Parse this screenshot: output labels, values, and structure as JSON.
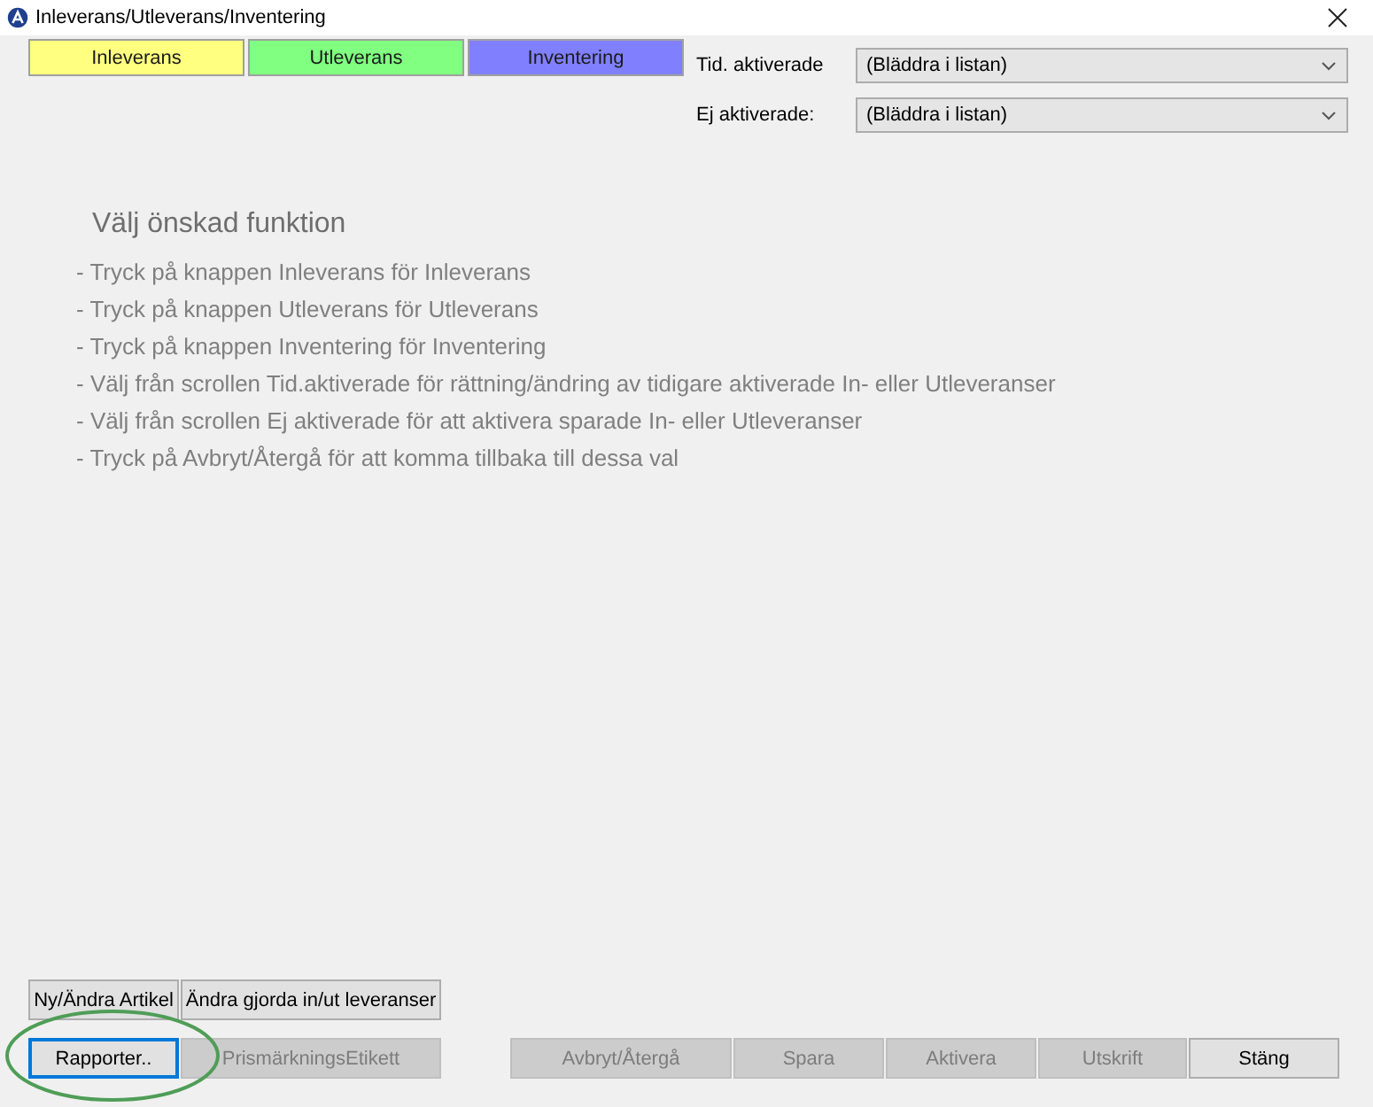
{
  "window": {
    "title": "Inleverans/Utleverans/Inventering"
  },
  "mode_buttons": [
    {
      "label": "Inleverans",
      "color": "#ffff80"
    },
    {
      "label": "Utleverans",
      "color": "#80ff80"
    },
    {
      "label": "Inventering",
      "color": "#8080ff"
    }
  ],
  "filters": [
    {
      "label": "Tid. aktiverade",
      "value": "(Bläddra i listan)"
    },
    {
      "label": "Ej aktiverade:",
      "value": "(Bläddra i listan)"
    }
  ],
  "instructions": {
    "heading": "Välj önskad funktion",
    "lines": [
      "- Tryck på knappen Inleverans för Inleverans",
      "- Tryck på knappen Utleverans för Utleverans",
      "- Tryck på knappen Inventering för Inventering",
      "- Välj från scrollen Tid.aktiverade för rättning/ändring av tidigare aktiverade In- eller Utleveranser",
      "- Välj från scrollen Ej aktiverade för att aktivera sparade In- eller Utleveranser",
      "- Tryck på Avbryt/Återgå för att komma tillbaka till dessa val"
    ]
  },
  "left_buttons": [
    {
      "label": "Ny/Ändra Artikel",
      "disabled": false,
      "focused": false
    },
    {
      "label": "Ändra gjorda in/ut leveranser",
      "disabled": false,
      "focused": false
    },
    {
      "label": "Rapporter..",
      "disabled": false,
      "focused": true
    },
    {
      "label": "PrismärkningsEtikett",
      "disabled": true,
      "focused": false
    }
  ],
  "right_buttons": [
    {
      "label": "Avbryt/Återgå",
      "disabled": true,
      "focused": false
    },
    {
      "label": "Spara",
      "disabled": true,
      "focused": false
    },
    {
      "label": "Aktivera",
      "disabled": true,
      "focused": false
    },
    {
      "label": "Utskrift",
      "disabled": true,
      "focused": false
    },
    {
      "label": "Stäng",
      "disabled": false,
      "focused": false
    }
  ]
}
